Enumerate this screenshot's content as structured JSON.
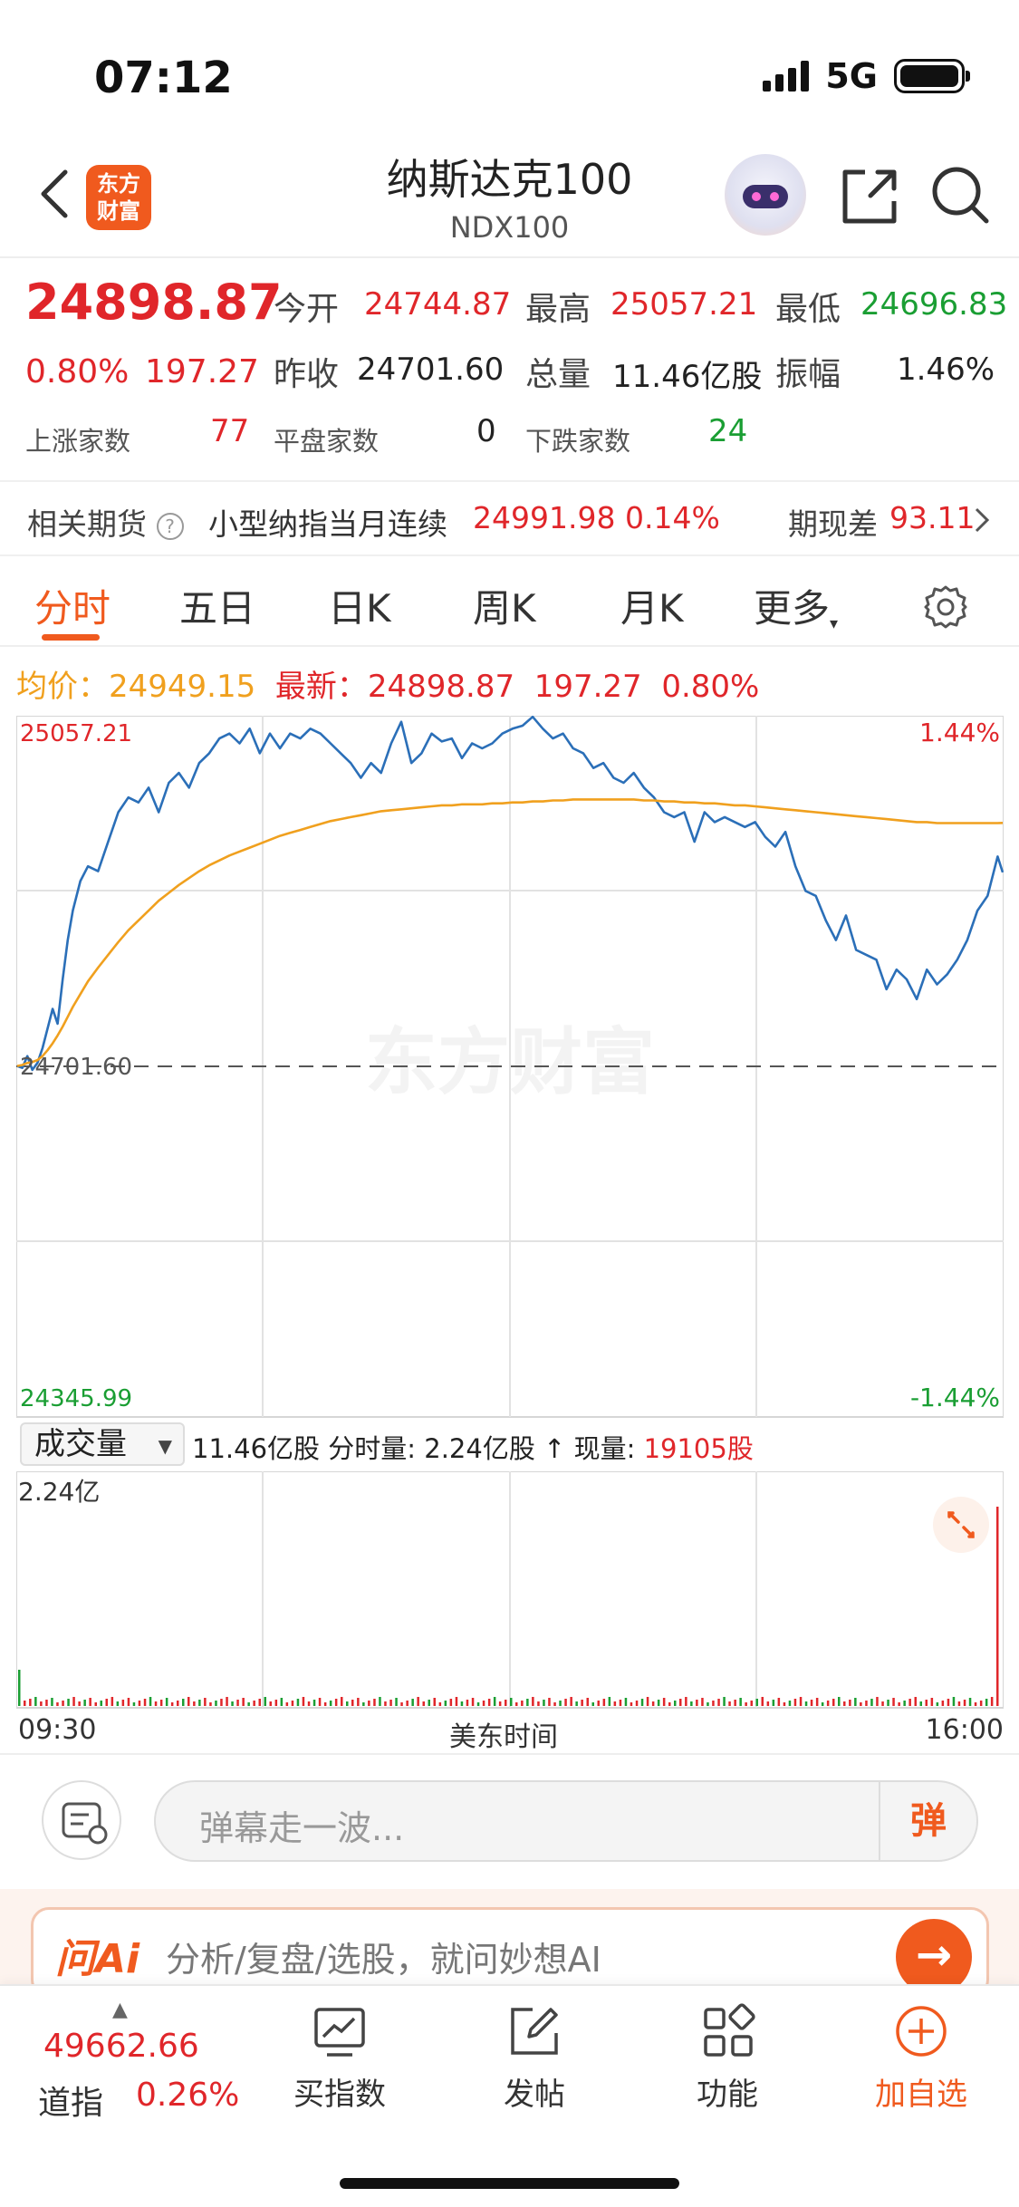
{
  "status": {
    "time": "07:12",
    "network": "5G"
  },
  "nav": {
    "logo_text": "东方\n财富",
    "title": "纳斯达克100",
    "subtitle": "NDX100"
  },
  "quote": {
    "price": "24898.87",
    "change_pct": "0.80%",
    "change": "197.27",
    "open_label": "今开",
    "open": "24744.87",
    "high_label": "最高",
    "high": "25057.21",
    "low_label": "最低",
    "low": "24696.83",
    "prev_close_label": "昨收",
    "prev_close": "24701.60",
    "volume_label": "总量",
    "volume": "11.46亿股",
    "amplitude_label": "振幅",
    "amplitude": "1.46%",
    "up_label": "上涨家数",
    "up_count": "77",
    "flat_label": "平盘家数",
    "flat_count": "0",
    "down_label": "下跌家数",
    "down_count": "24"
  },
  "futures": {
    "label": "相关期货",
    "name": "小型纳指当月连续",
    "price": "24991.98",
    "pct": "0.14%",
    "basis_label": "期现差",
    "basis": "93.11"
  },
  "tabs": [
    "分时",
    "五日",
    "日K",
    "周K",
    "月K",
    "更多"
  ],
  "info_line": {
    "avg_label": "均价：",
    "avg": "24949.15",
    "latest_label": "最新：",
    "latest": "24898.87",
    "change": "197.27",
    "pct": "0.80%"
  },
  "chart_data": {
    "type": "line",
    "title": "",
    "ylim": [
      24345.99,
      25057.21
    ],
    "y_labels": {
      "top": "25057.21",
      "mid": "24701.60",
      "bottom": "24345.99"
    },
    "pct_labels": {
      "top": "1.44%",
      "bottom": "-1.44%"
    },
    "watermark": "东方财富",
    "x_labels": [
      "09:30",
      "美东时间",
      "16:00"
    ],
    "x": [
      0,
      2,
      4,
      6,
      8,
      10,
      12,
      14,
      16,
      18,
      20,
      22,
      25,
      28,
      32,
      36,
      40,
      44,
      48,
      52,
      56,
      60,
      64,
      68,
      72,
      76,
      80,
      84,
      88,
      92,
      96,
      100,
      104,
      108,
      112,
      116,
      120,
      124,
      128,
      132,
      136,
      140,
      144,
      148,
      152,
      156,
      160,
      164,
      168,
      172,
      176,
      180,
      184,
      188,
      192,
      196,
      200,
      204,
      208,
      212,
      216,
      220,
      224,
      228,
      232,
      236,
      240,
      244,
      248,
      252,
      256,
      260,
      264,
      268,
      272,
      276,
      280,
      284,
      288,
      292,
      296,
      300,
      304,
      308,
      312,
      316,
      320,
      324,
      328,
      332,
      336,
      340,
      344,
      348,
      352,
      356,
      360,
      364,
      368,
      372,
      376,
      380,
      384,
      388,
      390
    ],
    "series": [
      {
        "values": [
          24702,
          24700,
          24712,
          24698,
          24705,
          24720,
          24740,
          24760,
          24745,
          24790,
          24830,
          24860,
          24890,
          24905,
          24900,
          24930,
          24960,
          24975,
          24970,
          24985,
          24960,
          24990,
          25000,
          24985,
          25010,
          25020,
          25035,
          25040,
          25030,
          25045,
          25020,
          25040,
          25025,
          25040,
          25035,
          25045,
          25040,
          25030,
          25020,
          25010,
          24995,
          25010,
          25000,
          25030,
          25052,
          25010,
          25020,
          25040,
          25032,
          25035,
          25015,
          25030,
          25025,
          25030,
          25040,
          25045,
          25048,
          25057,
          25045,
          25035,
          25040,
          25025,
          25020,
          25005,
          25010,
          24995,
          24990,
          25000,
          24985,
          24975,
          24960,
          24955,
          24960,
          24930,
          24960,
          24950,
          24955,
          24950,
          24945,
          24950,
          24935,
          24925,
          24940,
          24905,
          24880,
          24875,
          24850,
          24830,
          24855,
          24820,
          24815,
          24810,
          24780,
          24800,
          24790,
          24770,
          24800,
          24785,
          24795,
          24810,
          24830,
          24860,
          24875,
          24915,
          24898.87
        ]
      },
      {
        "values": [
          24702,
          24703,
          24705,
          24706,
          24708,
          24712,
          24718,
          24725,
          24733,
          24742,
          24752,
          24762,
          24775,
          24788,
          24802,
          24815,
          24828,
          24840,
          24850,
          24860,
          24870,
          24878,
          24886,
          24893,
          24900,
          24906,
          24911,
          24916,
          24920,
          24924,
          24928,
          24932,
          24936,
          24939,
          24942,
          24945,
          24948,
          24951,
          24953,
          24955,
          24957,
          24959,
          24961,
          24962,
          24963,
          24964,
          24965,
          24966,
          24967,
          24967,
          24968,
          24968,
          24968,
          24969,
          24969,
          24970,
          24970,
          24971,
          24971,
          24972,
          24972,
          24973,
          24973,
          24973,
          24973,
          24973,
          24973,
          24973,
          24972,
          24972,
          24971,
          24971,
          24970,
          24970,
          24969,
          24969,
          24968,
          24967,
          24967,
          24966,
          24965,
          24964,
          24963,
          24962,
          24961,
          24960,
          24959,
          24958,
          24957,
          24956,
          24955,
          24954,
          24953,
          24952,
          24951,
          24950,
          24950,
          24949,
          24949,
          24949,
          24949,
          24949,
          24949,
          24949,
          24949.15
        ]
      }
    ]
  },
  "volume": {
    "selector": "成交量",
    "total": "11.46亿股",
    "period_label": "分时量:",
    "period": "2.24亿股",
    "now_label": "现量:",
    "now": "19105股",
    "max_label": "2.24亿"
  },
  "danmaku": {
    "placeholder": "弹幕走一波...",
    "button": "弹"
  },
  "ai": {
    "logo": "问Ai",
    "text": "分析/复盘/选股，就问妙想AI"
  },
  "bottom": {
    "dow_value": "49662.66",
    "dow_name": "道指",
    "dow_pct": "0.26%",
    "items": [
      {
        "label": "买指数",
        "icon": "chart-trend-icon"
      },
      {
        "label": "发帖",
        "icon": "edit-icon"
      },
      {
        "label": "功能",
        "icon": "grid-icon"
      },
      {
        "label": "加自选",
        "icon": "plus-circle-icon"
      }
    ]
  },
  "colors": {
    "accent": "#f05a1e",
    "up": "#e0262a",
    "down": "#1a9e33",
    "price_line": "#2b6fb8",
    "avg_line": "#f0a01e"
  }
}
